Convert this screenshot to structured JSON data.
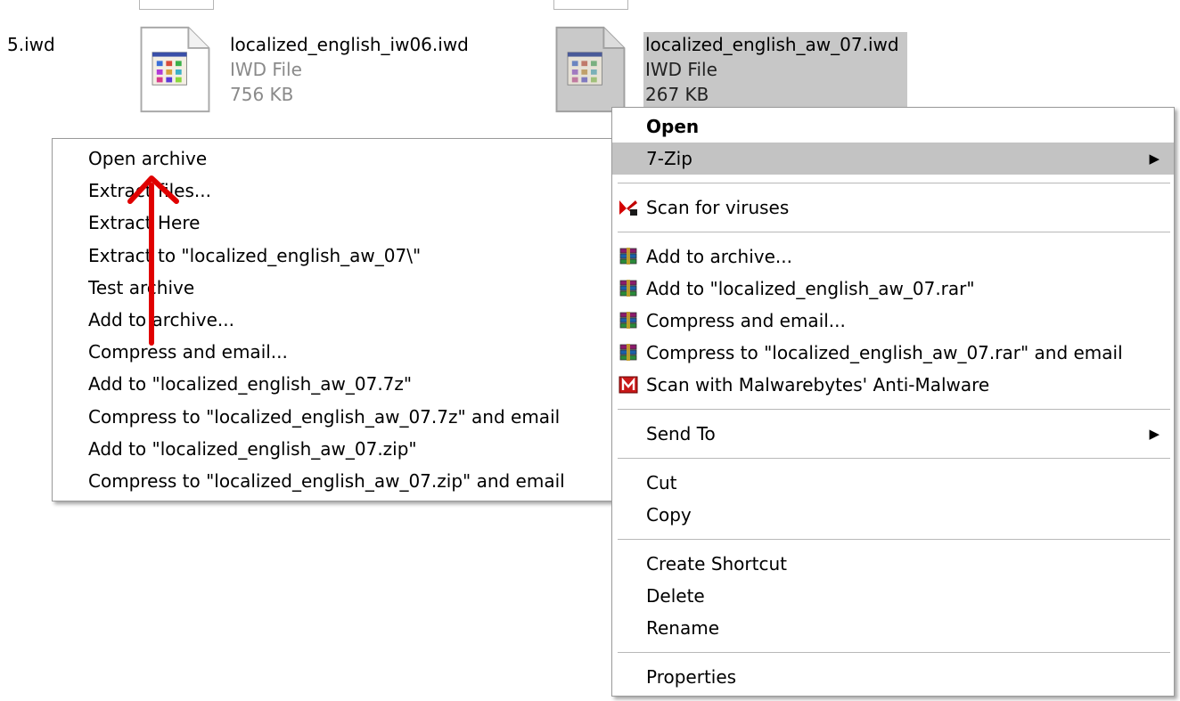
{
  "files": {
    "partial_left": "5.iwd",
    "file1": {
      "name": "localized_english_iw06.iwd",
      "type": "IWD File",
      "size": "756 KB"
    },
    "file2": {
      "name": "localized_english_aw_07.iwd",
      "type": "IWD File",
      "size": "267 KB"
    }
  },
  "submenu": {
    "items": [
      "Open archive",
      "Extract files...",
      "Extract Here",
      "Extract to \"localized_english_aw_07\\\"",
      "Test archive",
      "Add to archive...",
      "Compress and email...",
      "Add to \"localized_english_aw_07.7z\"",
      "Compress to \"localized_english_aw_07.7z\" and email",
      "Add to \"localized_english_aw_07.zip\"",
      "Compress to \"localized_english_aw_07.zip\" and email"
    ]
  },
  "context_menu": {
    "open": "Open",
    "seven_zip": "7-Zip",
    "scan_viruses": "Scan for viruses",
    "add_archive": "Add to archive...",
    "add_rar": "Add to \"localized_english_aw_07.rar\"",
    "compress_email": "Compress and email...",
    "compress_rar_email": "Compress to \"localized_english_aw_07.rar\" and email",
    "malwarebytes": "Scan with Malwarebytes' Anti-Malware",
    "send_to": "Send To",
    "cut": "Cut",
    "copy": "Copy",
    "create_shortcut": "Create Shortcut",
    "delete": "Delete",
    "rename": "Rename",
    "properties": "Properties"
  },
  "icons": {
    "file": "iwd-file-icon",
    "kaspersky": "kaspersky-icon",
    "winrar": "winrar-icon",
    "malwarebytes": "malwarebytes-icon",
    "submenu_arrow": "submenu-arrow-icon",
    "annotation": "red-arrow-annotation"
  },
  "colors": {
    "selection": "#c7c7c7",
    "menu_highlight": "#c3c3c3",
    "annotation_red": "#e00000"
  }
}
